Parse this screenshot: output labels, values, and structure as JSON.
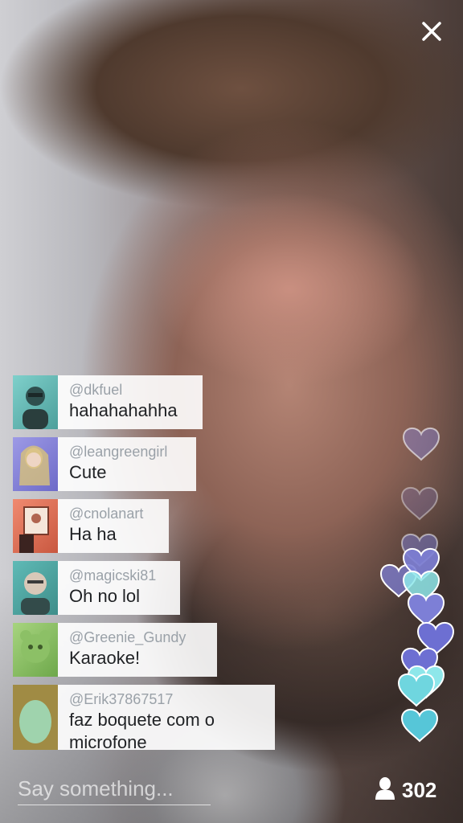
{
  "controls": {
    "close_icon": "close-icon"
  },
  "comments": [
    {
      "user": "@dkfuel",
      "text": "hahahahahha",
      "avatar": "avatar-dkfuel",
      "tint": "#5fb9b4"
    },
    {
      "user": "@leangreengirl",
      "text": "Cute",
      "avatar": "avatar-leangreengirl",
      "tint": "#7f7fd2"
    },
    {
      "user": "@cnolanart",
      "text": "Ha ha",
      "avatar": "avatar-cnolanart",
      "tint": "#d86a52"
    },
    {
      "user": "@magicski81",
      "text": "Oh no lol",
      "avatar": "avatar-magicski81",
      "tint": "#4fa9a6"
    },
    {
      "user": "@Greenie_Gundy",
      "text": "Karaoke!",
      "avatar": "avatar-greenie",
      "tint": "#8cc066"
    },
    {
      "user": "@Erik37867517",
      "text": "faz boquete com o microfone",
      "avatar": "avatar-egg",
      "tint": "#8ac7a3"
    }
  ],
  "input": {
    "placeholder": "Say something..."
  },
  "viewers": {
    "count": "302",
    "icon": "person-icon"
  },
  "hearts": {
    "icon": "heart-icon",
    "colors": [
      "#7d7fd6",
      "#8ee7ea",
      "#56c6d8"
    ]
  }
}
